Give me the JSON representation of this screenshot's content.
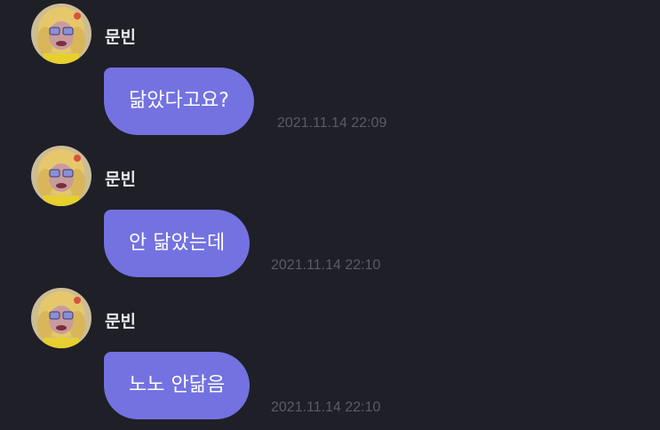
{
  "messages": [
    {
      "sender": "문빈",
      "text": "닮았다고요?",
      "time": "2021.11.14 22:09"
    },
    {
      "sender": "문빈",
      "text": "안 닮았는데",
      "time": "2021.11.14 22:10"
    },
    {
      "sender": "문빈",
      "text": "노노 안닮음",
      "time": "2021.11.14 22:10"
    }
  ],
  "colors": {
    "background": "#1f1f27",
    "bubble": "#7372e0",
    "timestamp": "#5b5b68",
    "sender": "#e8e8ee"
  }
}
